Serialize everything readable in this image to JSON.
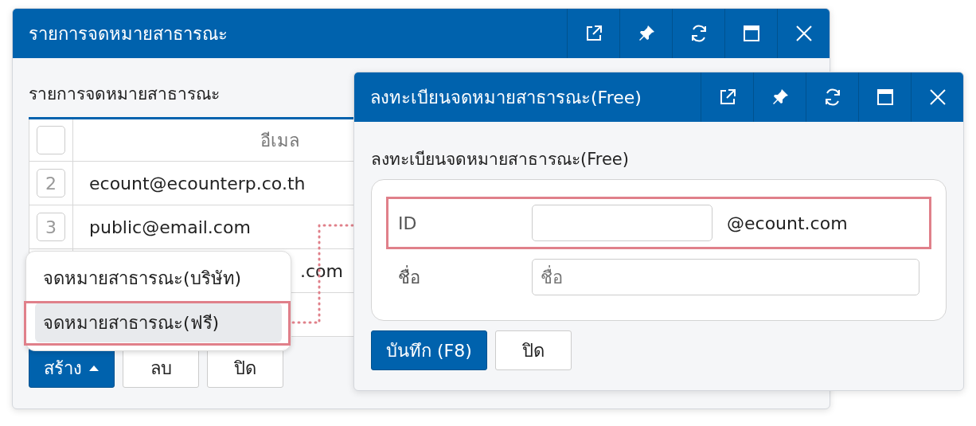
{
  "back_window": {
    "title": "รายการจดหมายสาธารณะ",
    "heading": "รายการจดหมายสาธารณะ",
    "table": {
      "select_all": {
        "checked": false
      },
      "columns": [
        {
          "label": "อีเมล"
        }
      ],
      "rows": [
        {
          "kind": "full",
          "number": "2",
          "email": "ecount@ecounterp.co.th"
        },
        {
          "kind": "full",
          "number": "3",
          "email": "public@email.com"
        },
        {
          "kind": "cut",
          "email": ".com"
        },
        {
          "kind": "blank"
        }
      ]
    },
    "buttons": [
      {
        "label": "สร้าง",
        "primary": true,
        "caret": true
      },
      {
        "label": "ลบ",
        "primary": false,
        "caret": false
      },
      {
        "label": "ปิด",
        "primary": false,
        "caret": false
      }
    ],
    "menu": {
      "items": [
        {
          "label": "จดหมายสาธารณะ(บริษัท)",
          "selected": false,
          "highlighted": false
        },
        {
          "label": "จดหมายสาธารณะ(ฟรี)",
          "selected": true,
          "highlighted": true
        }
      ]
    }
  },
  "front_window": {
    "title": "ลงทะเบียนจดหมายสาธารณะ(Free)",
    "heading": "ลงทะเบียนจดหมายสาธารณะ(Free)",
    "fields": [
      {
        "label": "ID",
        "suffix": "@ecount.com",
        "highlighted": true
      },
      {
        "label": "ชื่อ",
        "placeholder": "ชื่อ",
        "highlighted": false
      }
    ],
    "buttons": [
      {
        "label": "บันทึก (F8)",
        "primary": true
      },
      {
        "label": "ปิด",
        "primary": false
      }
    ]
  }
}
